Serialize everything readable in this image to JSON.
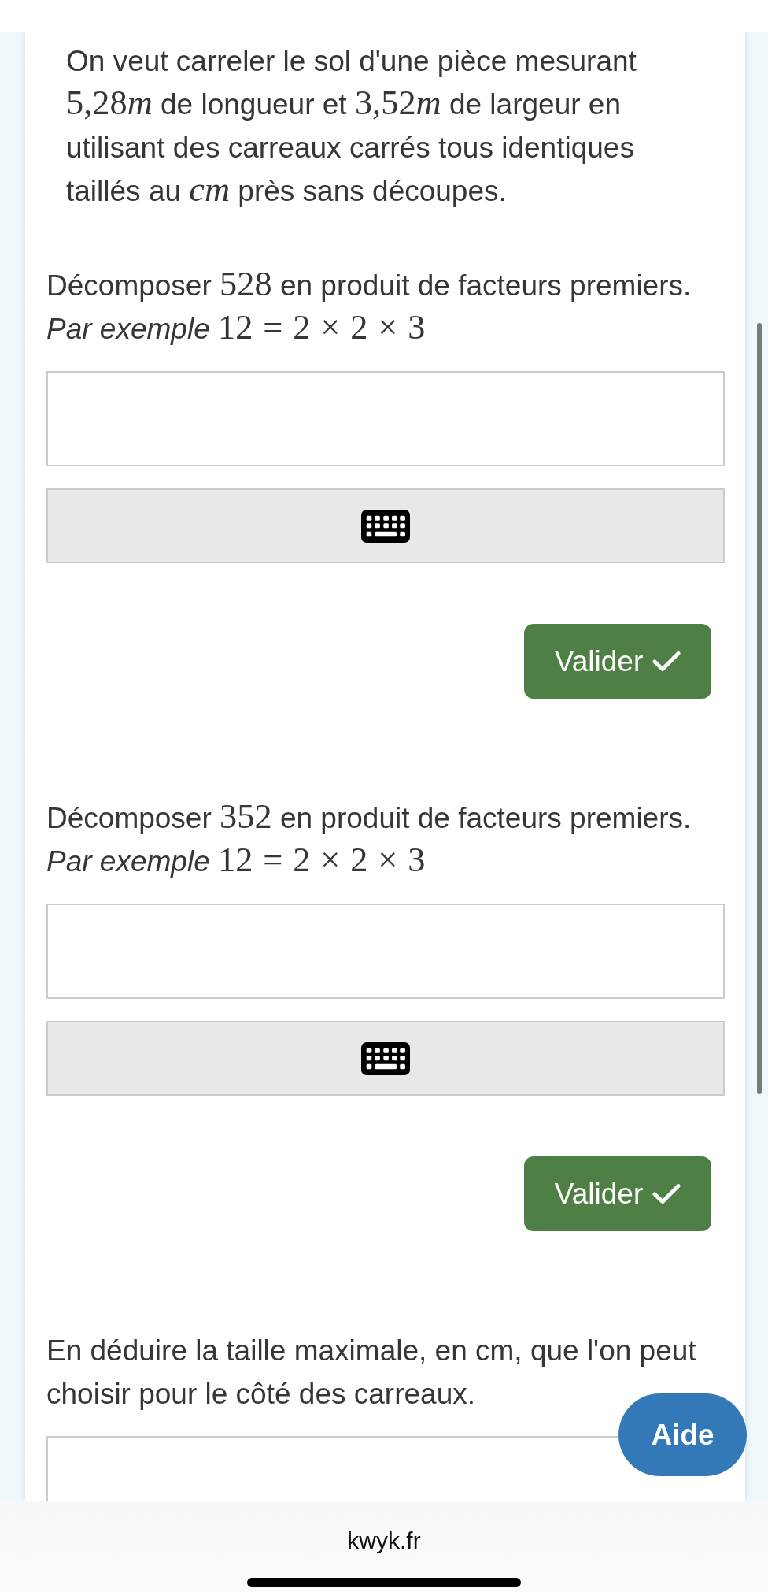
{
  "statement": [
    {
      "kind": "text",
      "text": "On veut carreler le sol d'une pièce mesurant "
    },
    {
      "kind": "math",
      "text": "5,28"
    },
    {
      "kind": "variable",
      "text": "m"
    },
    {
      "kind": "text",
      "text": " de longueur et "
    },
    {
      "kind": "math",
      "text": "3,52"
    },
    {
      "kind": "variable",
      "text": "m"
    },
    {
      "kind": "text",
      "text": " de largeur en utilisant des carreaux carrés tous identiques taillés au "
    },
    {
      "kind": "variable",
      "text": "cm"
    },
    {
      "kind": "text",
      "text": " près sans découpes."
    }
  ],
  "questions": [
    {
      "kind": "factorize",
      "prompt": [
        {
          "kind": "text",
          "text": "Décomposer "
        },
        {
          "kind": "math",
          "text": "528"
        },
        {
          "kind": "text",
          "text": " en produit de facteurs premiers."
        }
      ],
      "example": [
        {
          "kind": "text",
          "text": "*Par exemple* "
        },
        {
          "kind": "math",
          "text": "12 = 2 × 2 × 3"
        }
      ],
      "submit": {
        "label": "Valider"
      }
    },
    {
      "kind": "factorize",
      "prompt": [
        {
          "kind": "text",
          "text": "Décomposer "
        },
        {
          "kind": "math",
          "text": "352"
        },
        {
          "kind": "text",
          "text": " en produit de facteurs premiers."
        }
      ],
      "example": [
        {
          "kind": "text",
          "text": "*Par exemple* "
        },
        {
          "kind": "math",
          "text": "12 = 2 × 2 × 3"
        }
      ],
      "submit": {
        "label": "Valider"
      }
    },
    {
      "kind": "open",
      "prompt": [
        {
          "kind": "text",
          "text": "En déduire la taille maximale, en cm, que l'on peut choisir pour le côté des carreaux."
        }
      ]
    }
  ],
  "help_button": {
    "label": "Aide"
  },
  "browser_bar": {
    "url": "kwyk.fr"
  }
}
